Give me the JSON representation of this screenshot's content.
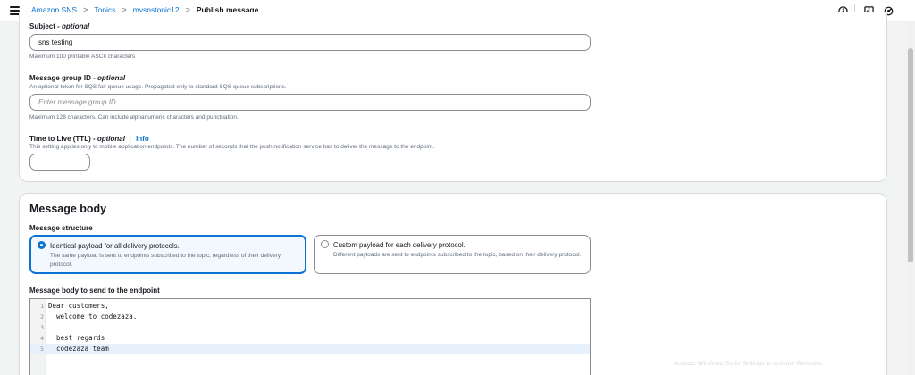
{
  "breadcrumb": {
    "items": [
      "Amazon SNS",
      "Topics",
      "mysnstopic12"
    ],
    "current": "Publish message",
    "separator": ">"
  },
  "header_icons": [
    "info-icon",
    "feedback-icon",
    "settings-icon"
  ],
  "subject": {
    "label": "Subject",
    "optional": "- optional",
    "value": "sns testing",
    "hint": "Maximum 100 printable ASCII characters"
  },
  "message_group": {
    "label": "Message group ID",
    "optional": "- optional",
    "description": "An optional token for SQS fair queue usage. Propagated only to standard SQS queue subscriptions.",
    "placeholder": "Enter message group ID",
    "value": "",
    "hint": "Maximum 128 characters. Can include alphanumeric characters and punctuation."
  },
  "ttl": {
    "label": "Time to Live (TTL)",
    "optional": "- optional",
    "info": "Info",
    "description": "This setting applies only to mobile application endpoints. The number of seconds that the push notification service has to deliver the message to the endpoint.",
    "value": ""
  },
  "message_body": {
    "heading": "Message body",
    "structure_label": "Message structure",
    "options": [
      {
        "title": "Identical payload for all delivery protocols.",
        "description": "The same payload is sent to endpoints subscribed to the topic, regardless of their delivery protocol.",
        "selected": true
      },
      {
        "title": "Custom payload for each delivery protocol.",
        "description": "Different payloads are sent to endpoints subscribed to the topic, based on their delivery protocol.",
        "selected": false
      }
    ],
    "editor_label": "Message body to send to the endpoint",
    "lines": [
      {
        "number": "1",
        "text": "Dear customers,"
      },
      {
        "number": "2",
        "text": "  welcome to codezaza."
      },
      {
        "number": "3",
        "text": ""
      },
      {
        "number": "4",
        "text": "  best regards"
      },
      {
        "number": "5",
        "text": "  codezaza team"
      }
    ],
    "active_line": 5
  },
  "watermark": "Activate Windows Go to Settings to activate Windows.",
  "colors": {
    "accent": "#0972d3",
    "text": "#16191f",
    "muted": "#5f6b7a",
    "border": "#8c8c94",
    "page_bg": "#f2f3f3",
    "selected_tile_bg": "#f2f8fd"
  }
}
